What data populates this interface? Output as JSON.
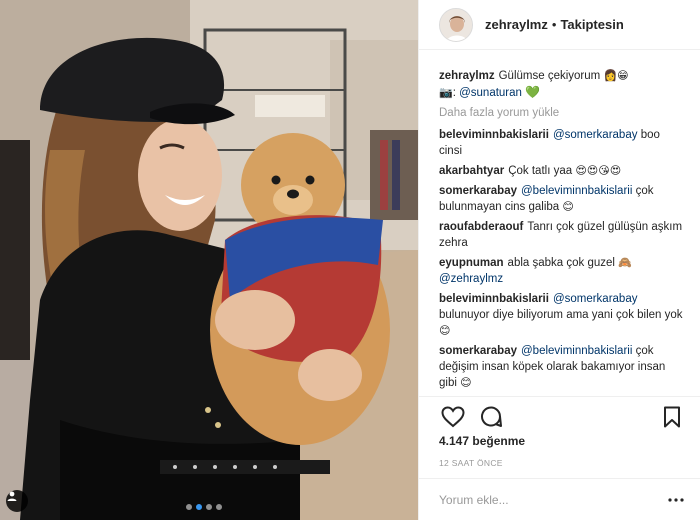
{
  "post": {
    "author": "zehraylmz",
    "follow_state": "Takiptesin",
    "separator": "•"
  },
  "caption": {
    "user": "zehraylmz",
    "text": "Gülümse çekiyorum",
    "emoji_1": "👩",
    "emoji_2": "😁",
    "camera_emoji": "📷",
    "sep": ":",
    "mention": "@sunaturan",
    "heart": "💚"
  },
  "load_more": "Daha fazla yorum yükle",
  "comments": [
    {
      "user": "beleviminnbakislarii",
      "mention": "@somerkarabay",
      "text": "boo cinsi",
      "emoji": ""
    },
    {
      "user": "akarbahtyar",
      "mention": "",
      "text": "Çok tatlı yaa",
      "emoji": "😍😍😘😍"
    },
    {
      "user": "somerkarabay",
      "mention": "@beleviminnbakislarii",
      "text": "çok bulunmayan cins galiba",
      "emoji": "😊"
    },
    {
      "user": "raoufabderaouf",
      "mention": "",
      "text": "Tanrı çok güzel gülüşün aşkım zehra",
      "emoji": ""
    },
    {
      "user": "eyupnuman",
      "mention": "",
      "text": "abla şabka çok guzel",
      "emoji": "🙈",
      "trail_mention": "@zehraylmz"
    },
    {
      "user": "beleviminnbakislarii",
      "mention": "@somerkarabay",
      "text": "bulunuyor diye biliyorum ama yani çok bilen yok",
      "emoji": "😊"
    },
    {
      "user": "somerkarabay",
      "mention": "@beleviminnbakislarii",
      "text": "çok değişim insan köpek olarak bakamıyor insan gibi",
      "emoji": "😊"
    }
  ],
  "likes": "4.147 beğenme",
  "timestamp": "12 SAAT ÖNCE",
  "comment_input": {
    "placeholder": "Yorum ekle..."
  },
  "icons": {
    "like": "heart-outline-icon",
    "comment": "speech-bubble-icon",
    "save": "bookmark-icon",
    "more": "more-dots-icon",
    "tag": "user-tag-icon"
  },
  "colors": {
    "mention": "#003569",
    "carousel_active": "#3897f0",
    "meta_text": "#999999",
    "divider": "#efefef"
  },
  "carousel": {
    "count": 4,
    "active_index": 1
  }
}
